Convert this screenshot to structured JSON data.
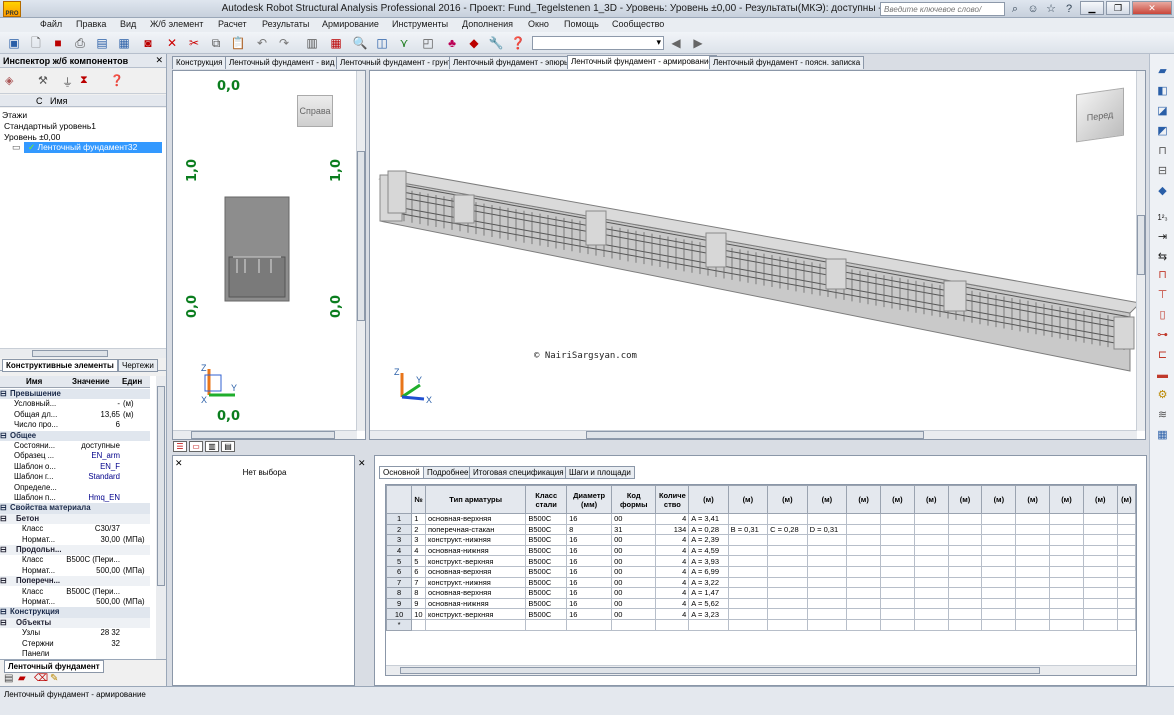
{
  "window": {
    "title": "Autodesk Robot Structural Analysis Professional 2016 - Проект: Fund_Tegelstenen 1_3D - Уровень: Уровень ±0,00 - Результаты(МКЭ): доступны - Результаты: доступные",
    "help_search_placeholder": "Введите ключевое слово/фразу",
    "logo_text": "PRO"
  },
  "menu": [
    "Файл",
    "Правка",
    "Вид",
    "Ж/б элемент",
    "Расчет",
    "Результаты",
    "Армирование",
    "Инструменты",
    "Дополнения",
    "Окно",
    "Помощь",
    "Сообщество"
  ],
  "toolbar": {
    "combo_value": ""
  },
  "inspector": {
    "title": "Инспектор ж/б компонентов",
    "col_c": "С",
    "col_name": "Имя",
    "tree": {
      "root": "Этажи",
      "level1": "Стандартный уровень1",
      "level2": "Уровень ±0,00",
      "selected": "Ленточный фундамент32"
    },
    "tabs": [
      "Конструктивные элементы",
      "Чертежи"
    ],
    "bottom_tab": "Ленточный фундамент",
    "prop_headers": [
      "Имя",
      "Значение",
      "Един"
    ],
    "props": [
      {
        "kind": "cat",
        "name": "Превышение"
      },
      {
        "kind": "row",
        "name": "Условный...",
        "value": "-",
        "unit": "(м)"
      },
      {
        "kind": "row",
        "name": "Общая дл...",
        "value": "13,65",
        "unit": "(м)"
      },
      {
        "kind": "row",
        "name": "Число про...",
        "value": "6",
        "unit": ""
      },
      {
        "kind": "cat",
        "name": "Общее"
      },
      {
        "kind": "row",
        "name": "Состояни...",
        "value": "доступные",
        "unit": ""
      },
      {
        "kind": "row",
        "name": "Образец ...",
        "value": "EN_arm",
        "unit": ""
      },
      {
        "kind": "row",
        "name": "Шаблон о...",
        "value": "EN_F",
        "unit": ""
      },
      {
        "kind": "row",
        "name": "Шаблон г...",
        "value": "Standard",
        "unit": ""
      },
      {
        "kind": "row",
        "name": "Определе...",
        "value": "",
        "unit": ""
      },
      {
        "kind": "row",
        "name": "Шаблон п...",
        "value": "Hmq_EN",
        "unit": ""
      },
      {
        "kind": "cat",
        "name": "Свойства материала"
      },
      {
        "kind": "sub",
        "name": "Бетон"
      },
      {
        "kind": "row2",
        "name": "Класс",
        "value": "C30/37",
        "unit": ""
      },
      {
        "kind": "row2",
        "name": "Нормат...",
        "value": "30,00",
        "unit": "(МПа)"
      },
      {
        "kind": "sub",
        "name": "Продольн..."
      },
      {
        "kind": "row2",
        "name": "Класс",
        "value": "B500C (Пери...",
        "unit": ""
      },
      {
        "kind": "row2",
        "name": "Нормат...",
        "value": "500,00",
        "unit": "(МПа)"
      },
      {
        "kind": "sub",
        "name": "Поперечн..."
      },
      {
        "kind": "row2",
        "name": "Класс",
        "value": "B500C (Пери...",
        "unit": ""
      },
      {
        "kind": "row2",
        "name": "Нормат...",
        "value": "500,00",
        "unit": "(МПа)"
      },
      {
        "kind": "cat",
        "name": "Конструкция"
      },
      {
        "kind": "sub",
        "name": "Объекты"
      },
      {
        "kind": "row2",
        "name": "Узлы",
        "value": "28 32",
        "unit": ""
      },
      {
        "kind": "row2",
        "name": "Стержни",
        "value": "32",
        "unit": ""
      },
      {
        "kind": "row2",
        "name": "Панели",
        "value": "",
        "unit": ""
      }
    ]
  },
  "doc_tabs": [
    "Конструкция",
    "Ленточный фундамент - вид",
    "Ленточный фундамент - грунт",
    "Ленточный фундамент - эпюры",
    "Ленточный фундамент - армирование",
    "Ленточный фундамент - поясн. записка"
  ],
  "active_doc_tab": 4,
  "view_left": {
    "viewcube_label": "Справа",
    "labels": {
      "top_left": "0,0",
      "mid_left_1": "1,0",
      "mid_right_1": "1,0",
      "mid_left_2": "0,0",
      "mid_right_2": "0,0",
      "bottom": "0,0"
    },
    "axis_z": "Z",
    "axis_y": "Y",
    "axis_x": "X"
  },
  "view_3d": {
    "viewcube_label": "Перед",
    "watermark": "© NairiSargsyan.com",
    "axis_z": "Z",
    "axis_y": "Y",
    "axis_x": "X"
  },
  "bottom_left": {
    "no_selection": "Нет выбора"
  },
  "bottom_tabs": [
    "Основной",
    "Подробнее",
    "Итоговая спецификация",
    "Шаги и площади"
  ],
  "table": {
    "headers": [
      "№",
      "Тип арматуры",
      "Класс стали",
      "Диаметр (мм)",
      "Код формы",
      "Количе ство",
      "(м)",
      "(м)",
      "(м)",
      "(м)",
      "(м)",
      "(м)",
      "(м)",
      "(м)",
      "(м)",
      "(м)",
      "(м)",
      "(м)",
      "(м)"
    ],
    "rows": [
      [
        "1",
        "1",
        "основная-верхняя",
        "B500C",
        "16",
        "00",
        "4",
        "A = 3,41",
        "",
        "",
        ""
      ],
      [
        "2",
        "2",
        "поперечная-стакан",
        "B500C",
        "8",
        "31",
        "134",
        "A = 0,28",
        "B = 0,31",
        "C = 0,28",
        "D = 0,31"
      ],
      [
        "3",
        "3",
        "конструкт.-нижняя",
        "B500C",
        "16",
        "00",
        "4",
        "A = 2,39",
        "",
        "",
        ""
      ],
      [
        "4",
        "4",
        "основная-нижняя",
        "B500C",
        "16",
        "00",
        "4",
        "A = 4,59",
        "",
        "",
        ""
      ],
      [
        "5",
        "5",
        "конструкт.-верхняя",
        "B500C",
        "16",
        "00",
        "4",
        "A = 3,93",
        "",
        "",
        ""
      ],
      [
        "6",
        "6",
        "основная-верхняя",
        "B500C",
        "16",
        "00",
        "4",
        "A = 6,99",
        "",
        "",
        ""
      ],
      [
        "7",
        "7",
        "конструкт.-нижняя",
        "B500C",
        "16",
        "00",
        "4",
        "A = 3,22",
        "",
        "",
        ""
      ],
      [
        "8",
        "8",
        "основная-верхняя",
        "B500C",
        "16",
        "00",
        "4",
        "A = 1,47",
        "",
        "",
        ""
      ],
      [
        "9",
        "9",
        "основная-нижняя",
        "B500C",
        "16",
        "00",
        "4",
        "A = 5,62",
        "",
        "",
        ""
      ],
      [
        "10",
        "10",
        "конструкт.-верхняя",
        "B500C",
        "16",
        "00",
        "4",
        "A = 3,23",
        "",
        "",
        ""
      ],
      [
        "*",
        "",
        "",
        "",
        "",
        "",
        "",
        "",
        "",
        "",
        ""
      ]
    ]
  },
  "status": {
    "text": "Ленточный фундамент - армирование"
  }
}
